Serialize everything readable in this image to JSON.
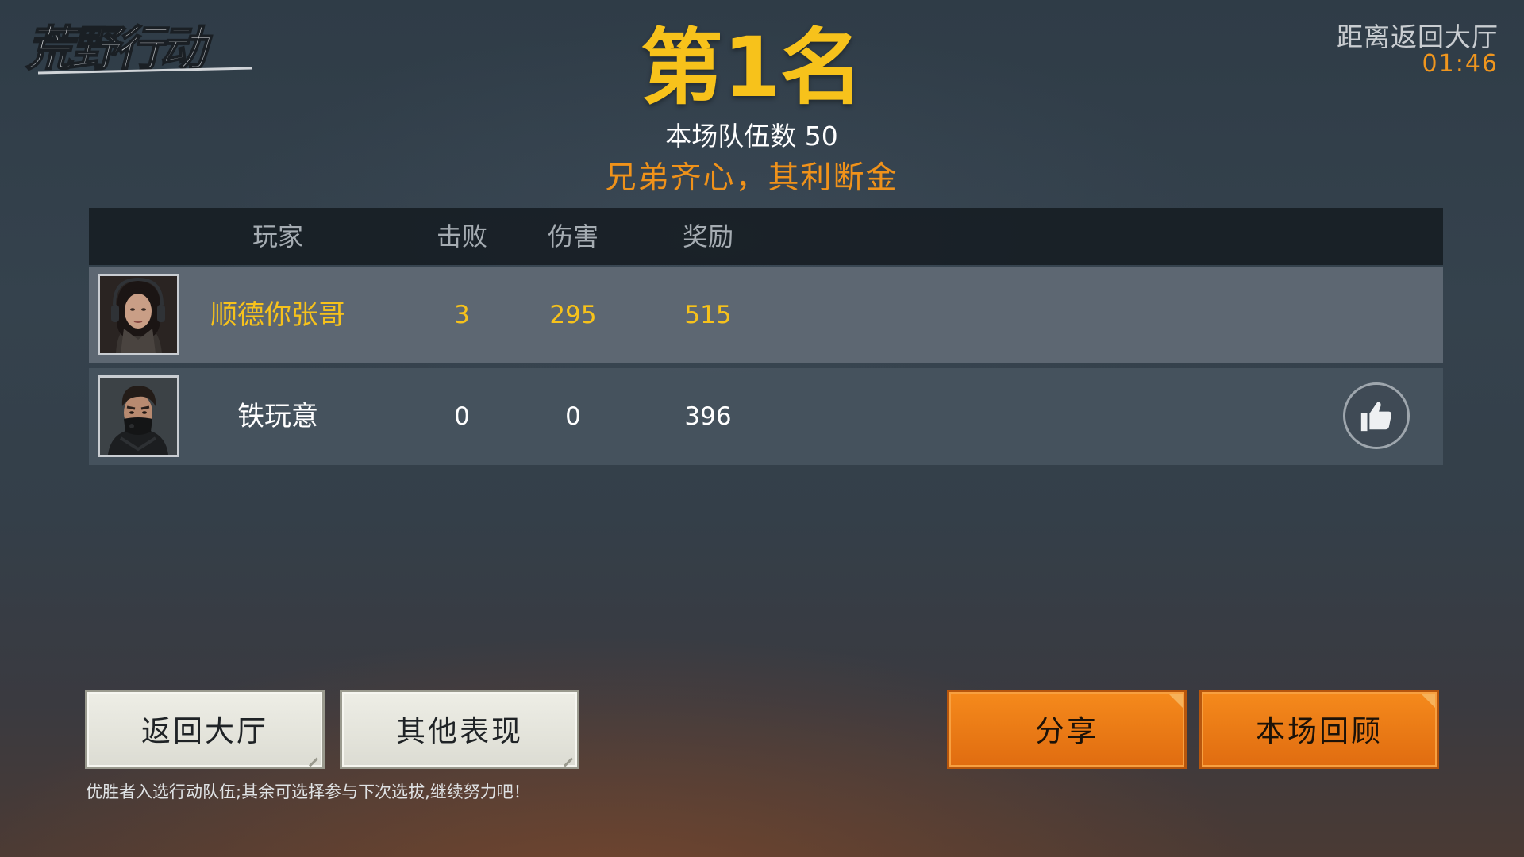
{
  "logo": {
    "text": "荒野行动"
  },
  "countdown": {
    "label": "距离返回大厅",
    "time": "01:46"
  },
  "result": {
    "rank": "第1名",
    "team_count": "本场队伍数 50",
    "slogan": "兄弟齐心，其利断金"
  },
  "table": {
    "headers": {
      "player": "玩家",
      "kills": "击败",
      "damage": "伤害",
      "reward": "奖励"
    },
    "rows": [
      {
        "player": "顺德你张哥",
        "kills": "3",
        "damage": "295",
        "reward": "515",
        "avatar_icon": "female-soldier-avatar"
      },
      {
        "player": "铁玩意",
        "kills": "0",
        "damage": "0",
        "reward": "396",
        "avatar_icon": "masked-male-avatar"
      }
    ]
  },
  "buttons": {
    "return_lobby": "返回大厅",
    "other_performance": "其他表现",
    "share": "分享",
    "match_review": "本场回顾"
  },
  "footer_note": "优胜者入选行动队伍;其余可选择参与下次选拔,继续努力吧！",
  "colors": {
    "rank_gold": "#f7c21b",
    "accent_orange": "#f0921a",
    "button_orange": "#f58a1c"
  }
}
